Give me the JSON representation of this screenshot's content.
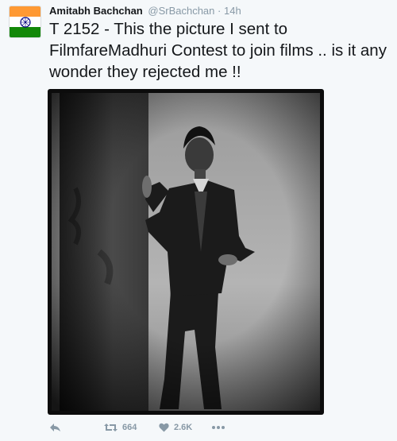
{
  "tweet": {
    "author_name": "Amitabh Bachchan",
    "handle": "@SrBachchan",
    "separator": "·",
    "time": "14h",
    "text": "T 2152 - This the picture I sent to FilmfareMadhuri Contest to join films .. is it any wonder they rejected me !!",
    "avatar": {
      "icon": "india-flag-avatar",
      "colors": [
        "#ff9933",
        "#ffffff",
        "#138808",
        "#000080"
      ]
    },
    "media": {
      "icon": "black-and-white-photo"
    }
  },
  "actions": {
    "reply": {
      "icon": "reply-icon"
    },
    "retweet": {
      "icon": "retweet-icon",
      "count": "664"
    },
    "like": {
      "icon": "heart-icon",
      "count": "2.6K"
    },
    "more": {
      "icon": "more-icon"
    }
  },
  "colors": {
    "text": "#14171a",
    "muted": "#8899a6",
    "background": "#f5f8fa"
  }
}
